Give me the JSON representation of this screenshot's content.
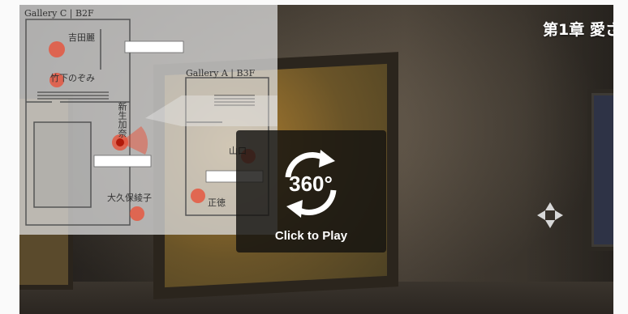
{
  "viewer": {
    "chapter_title": "第1章 愛さ",
    "play_badge": "360°",
    "play_label": "Click to Play"
  },
  "floor_map": {
    "gallery_c": "Gallery C | B2F",
    "gallery_a": "Gallery A | B3F",
    "names": [
      "吉田麗",
      "竹下のぞみ",
      "新生加奈",
      "大久保綾子",
      "山口",
      "正徳"
    ]
  },
  "colors": {
    "marker": "#e8523a",
    "overlay": "#141210",
    "map_bg": "#d7d7d7"
  }
}
